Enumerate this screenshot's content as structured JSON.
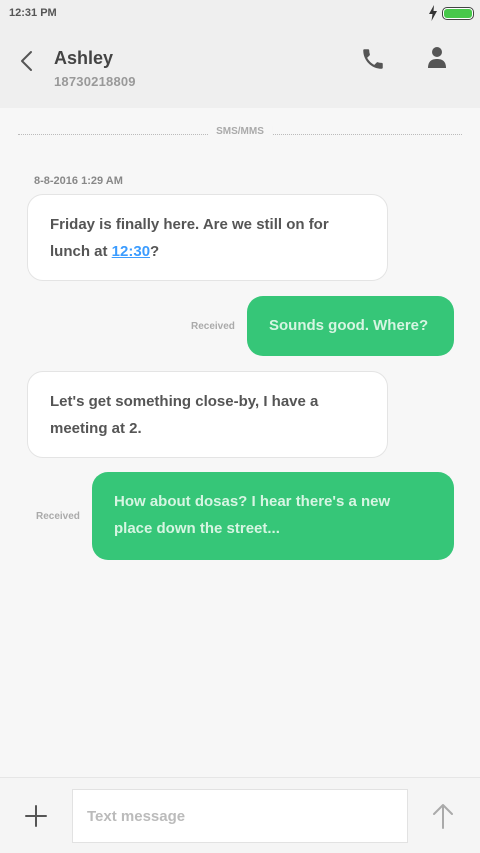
{
  "status_bar": {
    "time": "12:31 PM"
  },
  "header": {
    "name": "Ashley",
    "number": "18730218809"
  },
  "channel_label": "SMS/MMS",
  "timestamp": "8-8-2016 1:29 AM",
  "messages": [
    {
      "text_before_link": "Friday is finally here. Are we still on for lunch at ",
      "link": "12:30",
      "text_after_link": "?"
    },
    {
      "text": "Sounds good. Where?",
      "status": "Received"
    },
    {
      "text": "Let's get something close-by, I have a meeting at 2."
    },
    {
      "text": "How about dosas? I hear there's a new place down the street...",
      "status": "Received"
    }
  ],
  "composer": {
    "placeholder": "Text message"
  },
  "colors": {
    "accent": "#36c678",
    "link": "#3b9cff",
    "battery": "#47c84a"
  }
}
